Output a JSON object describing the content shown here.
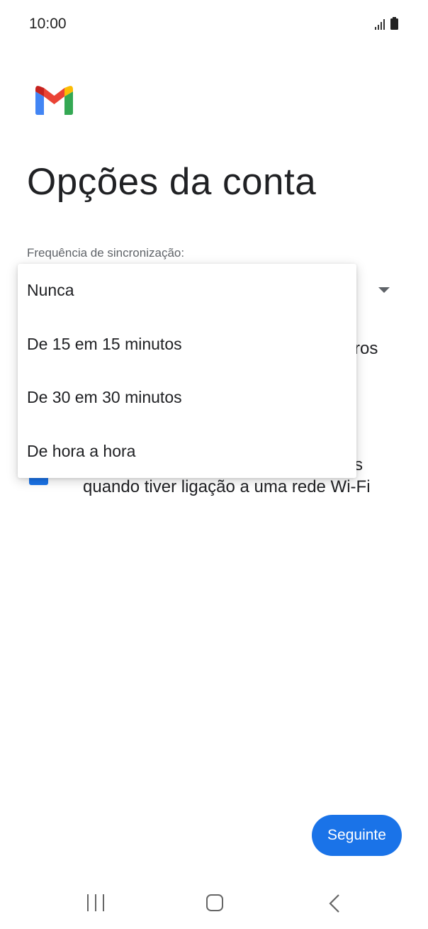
{
  "status_bar": {
    "time": "10:00"
  },
  "header": {
    "title": "Opções da conta"
  },
  "sync": {
    "label": "Frequência de sincronização:",
    "options": [
      "Nunca",
      "De 15 em 15 minutos",
      "De 30 em 30 minutos",
      "De hora a hora"
    ]
  },
  "background": {
    "partial_text_1": "ros",
    "partial_text_2": "s",
    "wifi_option": "quando tiver ligação a uma rede Wi-Fi"
  },
  "footer": {
    "next_label": "Seguinte"
  },
  "colors": {
    "accent": "#1a73e8"
  },
  "icons": {
    "logo": "gmail-logo",
    "dropdown": "caret-down-icon",
    "signal": "signal-icon",
    "battery": "battery-icon",
    "recents": "recents-icon",
    "home": "home-icon",
    "back": "back-icon"
  }
}
